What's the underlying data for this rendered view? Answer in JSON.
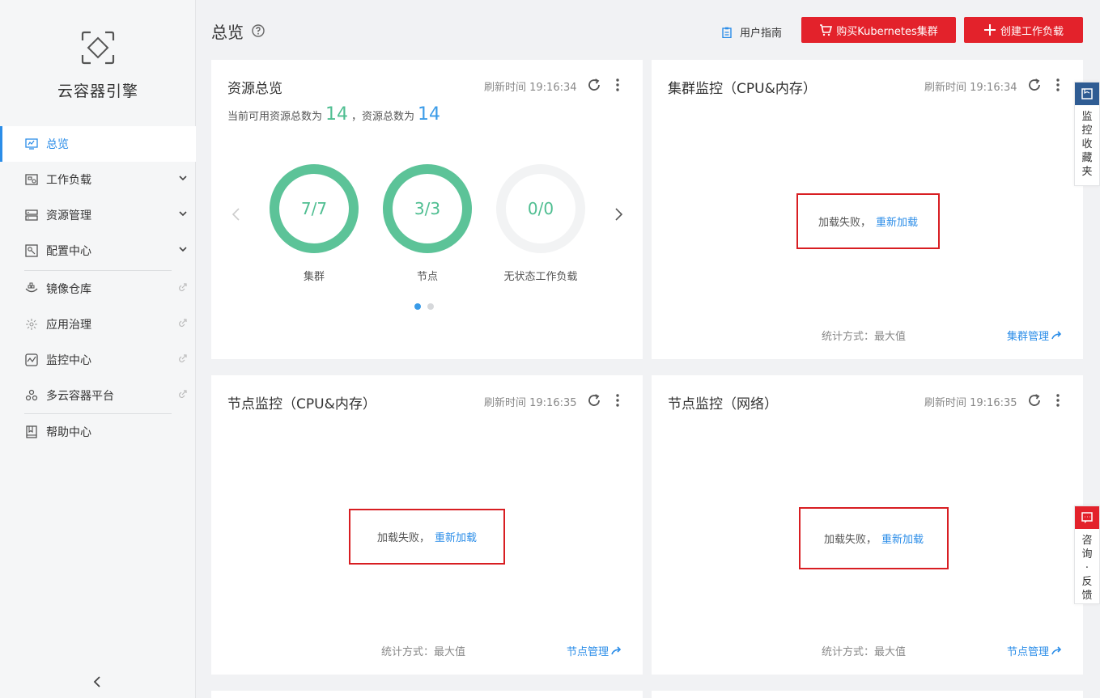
{
  "sidebar": {
    "brand": "云容器引擎",
    "items": [
      {
        "label": "总览"
      },
      {
        "label": "工作负载"
      },
      {
        "label": "资源管理"
      },
      {
        "label": "配置中心"
      },
      {
        "label": "镜像仓库"
      },
      {
        "label": "应用治理"
      },
      {
        "label": "监控中心"
      },
      {
        "label": "多云容器平台"
      },
      {
        "label": "帮助中心"
      }
    ]
  },
  "header": {
    "title": "总览",
    "guide_label": "用户指南",
    "buy_label": "购买Kubernetes集群",
    "create_label": "创建工作负载"
  },
  "resource_card": {
    "title": "资源总览",
    "refresh": "刷新时间 19:16:34",
    "summary_prefix": "当前可用资源总数为",
    "available_total": "14",
    "summary_mid": "，资源总数为",
    "total": "14",
    "rings": [
      {
        "value": "7/7",
        "label": "集群",
        "fraction": 1.0
      },
      {
        "value": "3/3",
        "label": "节点",
        "fraction": 1.0
      },
      {
        "value": "0/0",
        "label": "无状态工作负载",
        "fraction": 0.0
      }
    ]
  },
  "cluster_card": {
    "title": "集群监控（CPU&内存）",
    "refresh": "刷新时间 19:16:34",
    "fail_text": "加载失败，",
    "reload": "重新加载",
    "stat": "统计方式：最大值",
    "link": "集群管理"
  },
  "node_card": {
    "title": "节点监控（CPU&内存）",
    "refresh": "刷新时间 19:16:35",
    "fail_text": "加载失败，",
    "reload": "重新加载",
    "stat": "统计方式：最大值",
    "link": "节点管理"
  },
  "network_card": {
    "title": "节点监控（网络）",
    "refresh": "刷新时间 19:16:35",
    "fail_text": "加载失败，",
    "reload": "重新加载",
    "stat": "统计方式：最大值",
    "link": "节点管理"
  },
  "float_tabs": {
    "monitor_fav": "监控收藏夹",
    "feedback": "咨询·反馈"
  },
  "colors": {
    "accent_blue": "#2b8de8",
    "brand_red": "#e3222b",
    "ring_green": "#4fbe91"
  }
}
